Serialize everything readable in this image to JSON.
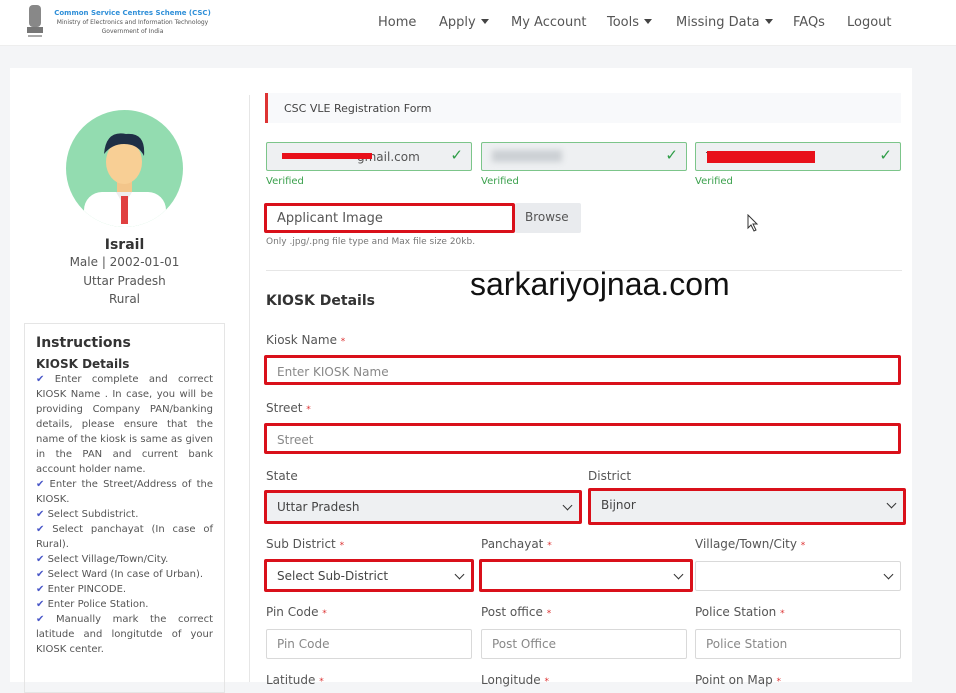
{
  "brand": {
    "line1": "Common Service Centres Scheme (CSC)",
    "line2": "Ministry of Electronics and Information Technology",
    "line3": "Government of India"
  },
  "nav": {
    "items": [
      {
        "label": "Home"
      },
      {
        "label": "Apply"
      },
      {
        "label": "My Account"
      },
      {
        "label": "Tools"
      },
      {
        "label": "Missing Data"
      },
      {
        "label": "FAQs"
      },
      {
        "label": "Logout"
      }
    ]
  },
  "profile": {
    "name": "Israil",
    "gender_dob": "Male | 2002-01-01",
    "state": "Uttar Pradesh",
    "area": "Rural"
  },
  "instructions": {
    "title": "Instructions",
    "section": "KIOSK Details",
    "items": [
      "Enter complete and correct KIOSK Name . In case, you will be providing Company PAN/banking details, please ensure that the name of the kiosk is same as given in the PAN and current bank account holder name.",
      "Enter the Street/Address of the KIOSK.",
      "Select Subdistrict.",
      "Select panchayat (In case of Rural).",
      "Select Village/Town/City.",
      "Select Ward (In case of Urban).",
      "Enter PINCODE.",
      "Enter Police Station.",
      "Manually mark the correct latitude and longitutde of your KIOSK center."
    ]
  },
  "form": {
    "title": "CSC VLE Registration Form",
    "verified": [
      {
        "value": "gmail.com",
        "status": "Verified"
      },
      {
        "value": "",
        "status": "Verified"
      },
      {
        "value": "T",
        "status": "Verified"
      }
    ],
    "applicant_image": "Applicant Image",
    "browse": "Browse",
    "hint": "Only .jpg/.png file type and Max file size 20kb.",
    "section": "KIOSK Details",
    "watermark": "sarkariyojnaa.com",
    "kiosk_name": {
      "label": "Kiosk Name",
      "placeholder": "Enter KIOSK Name"
    },
    "street": {
      "label": "Street",
      "placeholder": "Street"
    },
    "state": {
      "label": "State",
      "value": "Uttar Pradesh"
    },
    "district": {
      "label": "District",
      "value": "Bijnor"
    },
    "sub_district": {
      "label": "Sub District",
      "value": "Select Sub-District"
    },
    "panchayat": {
      "label": "Panchayat",
      "value": ""
    },
    "village": {
      "label": "Village/Town/City",
      "value": ""
    },
    "pin": {
      "label": "Pin Code",
      "placeholder": "Pin Code"
    },
    "post": {
      "label": "Post office",
      "placeholder": "Post Office"
    },
    "police": {
      "label": "Police Station",
      "placeholder": "Police Station"
    },
    "latitude": {
      "label": "Latitude"
    },
    "longitude": {
      "label": "Longitude"
    },
    "map": {
      "label": "Point on Map"
    },
    "required": "*"
  }
}
